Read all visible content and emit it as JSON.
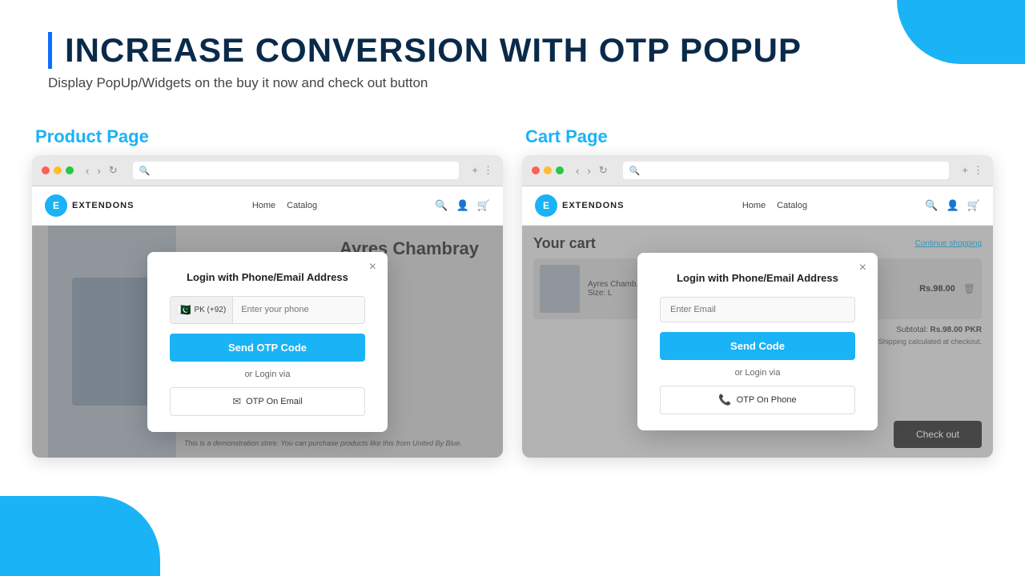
{
  "decorative": {
    "blob_top_right": "blob",
    "blob_bottom_left": "blob"
  },
  "header": {
    "title": "INCREASE CONVERSION WITH OTP POPUP",
    "subtitle": "Display PopUp/Widgets on the buy it now and check out button"
  },
  "product_section": {
    "label": "Product Page",
    "browser": {
      "dot_red": "red",
      "dot_yellow": "yellow",
      "dot_green": "green"
    },
    "store_nav": {
      "logo_text": "E",
      "store_name": "EXTENDONS",
      "menu_items": [
        "Home",
        "Catalog"
      ]
    },
    "product": {
      "title": "Ayres Chambray",
      "demo_text": "This is a demonstration store. You can purchase products like this from United By Blue."
    },
    "popup": {
      "title": "Login with Phone/Email Address",
      "close_label": "×",
      "phone_flag": "🇵🇰",
      "phone_code": "PK (+92)",
      "phone_placeholder": "Enter your phone",
      "send_otp_label": "Send OTP Code",
      "or_login": "or Login via",
      "alt_login_label": "OTP On Email"
    }
  },
  "cart_section": {
    "label": "Cart Page",
    "browser": {
      "dot_red": "red",
      "dot_yellow": "yellow",
      "dot_green": "green"
    },
    "store_nav": {
      "logo_text": "E",
      "store_name": "EXTENDONS",
      "menu_items": [
        "Home",
        "Catalog"
      ]
    },
    "cart": {
      "title": "Your cart",
      "continue_shopping": "Continue shopping",
      "item_name": "Ayres Chamb...",
      "item_size": "Size: L",
      "item_price": "Rs.98.00",
      "subtotal_label": "Subtotal:",
      "subtotal_value": "Rs.98.00 PKR",
      "subtotal_note": "Shipping calculated at checkout.",
      "checkout_label": "Check out"
    },
    "popup": {
      "title": "Login with Phone/Email Address",
      "close_label": "×",
      "email_placeholder": "Enter Email",
      "send_code_label": "Send Code",
      "or_login": "or Login via",
      "alt_login_label": "OTP On Phone"
    }
  }
}
